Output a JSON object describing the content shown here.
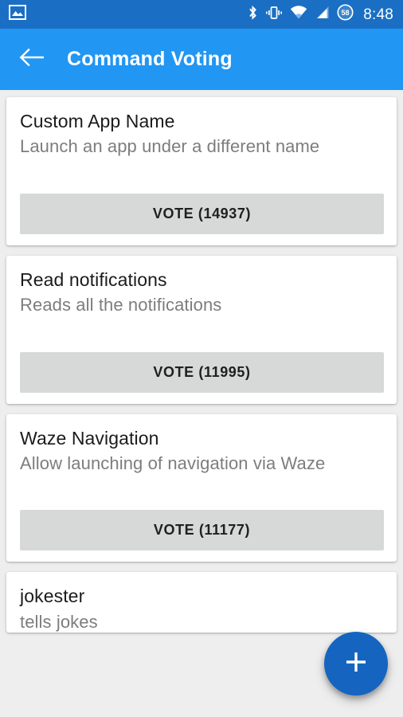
{
  "status_bar": {
    "background_color": "#1A6FC4",
    "time": "8:48",
    "battery_level": "58",
    "icons": [
      "image-notification-icon",
      "bluetooth-icon",
      "vibrate-icon",
      "wifi-icon",
      "cellular-signal-icon",
      "battery-icon"
    ]
  },
  "app_bar": {
    "background_color": "#2196F3",
    "title": "Command Voting",
    "back_icon": "arrow-back-icon"
  },
  "list": {
    "cards": [
      {
        "title": "Custom App Name",
        "subtitle": "Launch an app under a different name",
        "vote_label": "VOTE (14937)",
        "votes": 14937
      },
      {
        "title": "Read notifications",
        "subtitle": "Reads all the notifications",
        "vote_label": "VOTE (11995)",
        "votes": 11995
      },
      {
        "title": "Waze Navigation",
        "subtitle": "Allow launching of navigation via Waze",
        "vote_label": "VOTE (11177)",
        "votes": 11177
      },
      {
        "title": "jokester",
        "subtitle": "tells jokes",
        "vote_label": "",
        "votes": null
      }
    ]
  },
  "fab": {
    "icon": "plus-icon",
    "color": "#1565C0"
  },
  "theme": {
    "page_background": "#EEEEEE",
    "card_background": "#FFFFFF",
    "button_background": "#D7D8D8",
    "title_color": "#1B1B1B",
    "subtitle_color": "#7D7D7D"
  }
}
